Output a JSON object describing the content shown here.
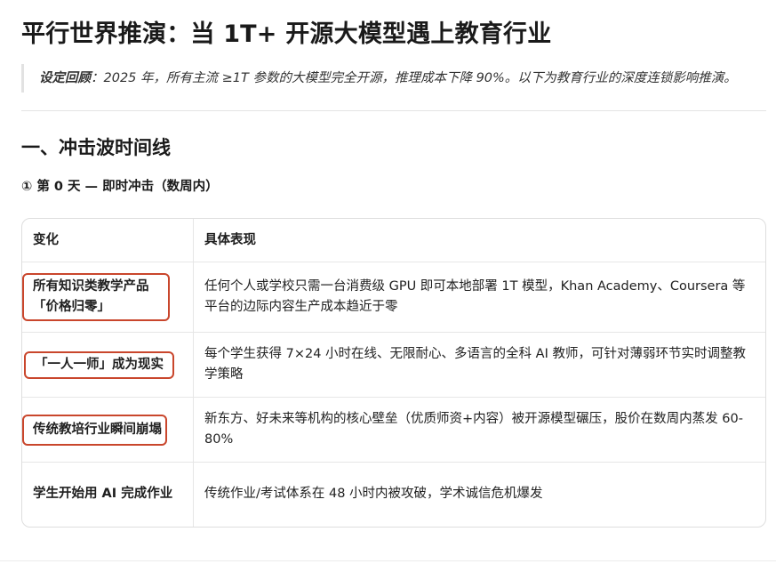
{
  "title": "平行世界推演：当 1T+ 开源大模型遇上教育行业",
  "quote": {
    "label": "设定回顾",
    "text": "：2025 年，所有主流 ≥1T 参数的大模型完全开源，推理成本下降 90%。以下为教育行业的深度连锁影响推演。"
  },
  "section": {
    "heading": "一、冲击波时间线",
    "subheading": "① 第 0 天 — 即时冲击（数周内）"
  },
  "table": {
    "headers": [
      "变化",
      "具体表现"
    ],
    "rows": [
      {
        "change": "所有知识类教学产品「价格归零」",
        "detail": "任何个人或学校只需一台消费级 GPU 即可本地部署 1T 模型，Khan Academy、Coursera 等平台的边际内容生产成本趋近于零",
        "highlighted": true
      },
      {
        "change": "「一人一师」成为现实",
        "detail": "每个学生获得 7×24 小时在线、无限耐心、多语言的全科 AI 教师，可针对薄弱环节实时调整教学策略",
        "highlighted": true
      },
      {
        "change": "传统教培行业瞬间崩塌",
        "detail": "新东方、好未来等机构的核心壁垒（优质师资+内容）被开源模型碾压，股价在数周内蒸发 60-80%",
        "highlighted": true
      },
      {
        "change": "学生开始用 AI 完成作业",
        "detail": "传统作业/考试体系在 48 小时内被攻破，学术诚信危机爆发",
        "highlighted": false
      }
    ]
  },
  "colors": {
    "highlight_border": "#c9462c",
    "text": "#1f1f1f",
    "border": "#dedede"
  }
}
